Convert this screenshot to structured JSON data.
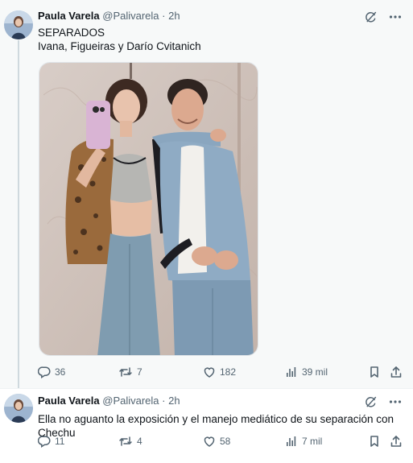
{
  "tweets": [
    {
      "author": "Paula Varela",
      "handle": "@Palivarela",
      "separator": "·",
      "time": "2h",
      "text_line1": "SEPARADOS",
      "text_line2": "Ivana, Figueiras y Darío Cvitanich",
      "stats": {
        "replies": "36",
        "retweets": "7",
        "likes": "182",
        "views": "39 mil"
      }
    },
    {
      "author": "Paula Varela",
      "handle": "@Palivarela",
      "separator": "·",
      "time": "2h",
      "text": "Ella no aguanto la exposición y el manejo mediático de su separación con Chechu",
      "stats": {
        "replies": "11",
        "retweets": "4",
        "likes": "58",
        "views": "7 mil"
      }
    }
  ],
  "icons": {
    "grok": "grok-icon",
    "more": "more-icon",
    "reply": "reply-icon",
    "retweet": "retweet-icon",
    "like": "heart-icon",
    "views": "views-icon",
    "bookmark": "bookmark-icon",
    "share": "share-icon"
  },
  "colors": {
    "text": "#0f1419",
    "secondary": "#536471",
    "background": "#f7f9f9"
  }
}
